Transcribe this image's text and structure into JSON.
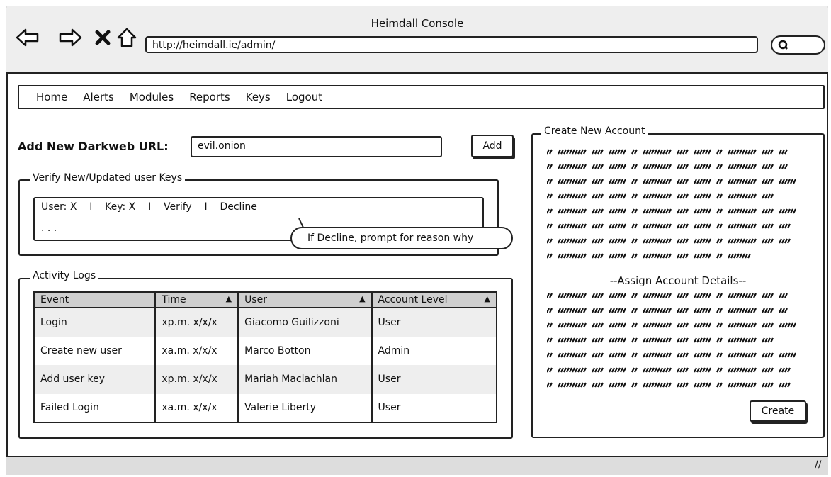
{
  "window": {
    "title": "Heimdall Console"
  },
  "browser": {
    "url": "http://heimdall.ie/admin/"
  },
  "menu": [
    "Home",
    "Alerts",
    "Modules",
    "Reports",
    "Keys",
    "Logout"
  ],
  "add_url": {
    "label": "Add New Darkweb URL:",
    "value": "evil.onion",
    "button": "Add"
  },
  "verify": {
    "legend": "Verify New/Updated user Keys",
    "line": "User: X    I    Key: X    I    Verify    I    Decline",
    "more": ". . .",
    "callout": "If Decline, prompt for reason why"
  },
  "activity": {
    "legend": "Activity Logs",
    "headers": [
      "Event",
      "Time",
      "User",
      "Account Level"
    ],
    "rows": [
      [
        "Login",
        "xp.m. x/x/x",
        "Giacomo Guilizzoni",
        "User"
      ],
      [
        "Create new user",
        "xa.m. x/x/x",
        "Marco Botton",
        "Admin"
      ],
      [
        "Add user key",
        "xp.m. x/x/x",
        "Mariah Maclachlan",
        "User"
      ],
      [
        "Failed Login",
        "xa.m. x/x/x",
        "Valerie Liberty",
        "User"
      ]
    ]
  },
  "create_account": {
    "legend": "Create New Account",
    "assign_title": "--Assign Account Details--",
    "button": "Create"
  }
}
